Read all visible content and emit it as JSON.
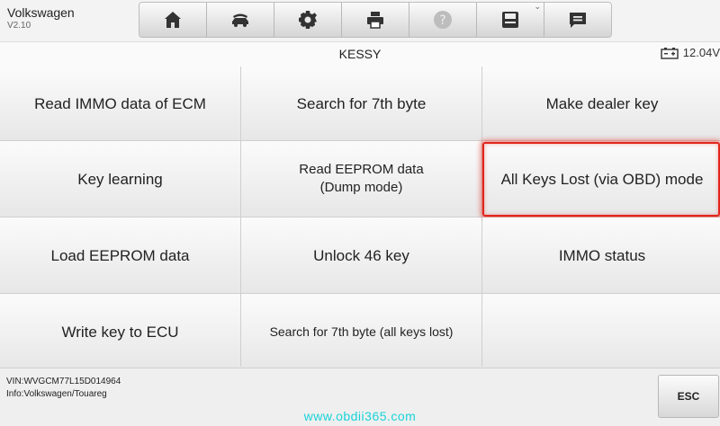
{
  "app": {
    "name": "Volkswagen",
    "version": "V2.10"
  },
  "toolbar": [
    {
      "icon": "home-icon"
    },
    {
      "icon": "vehicle-lift-icon"
    },
    {
      "icon": "gear-icon"
    },
    {
      "icon": "printer-icon"
    },
    {
      "icon": "help-icon"
    },
    {
      "icon": "save-icon"
    },
    {
      "icon": "message-icon"
    }
  ],
  "page": {
    "title": "KESSY",
    "battery_voltage": "12.04V"
  },
  "functions": [
    "Read IMMO data of ECM",
    "Search for 7th byte",
    "Make dealer key",
    "Key learning",
    "Read EEPROM data\n(Dump mode)",
    "All Keys Lost (via OBD) mode",
    "Load EEPROM data",
    "Unlock 46 key",
    "IMMO status",
    "Write key to ECU",
    "Search for 7th byte (all keys lost)",
    ""
  ],
  "footer": {
    "vin": "VIN:WVGCM77L15D014964",
    "info": "Info:Volkswagen/Touareg",
    "esc_label": "ESC"
  },
  "watermark": "www.obdii365.com",
  "colors": {
    "highlight": "#e2261c",
    "watermark": "#19d3d8"
  }
}
